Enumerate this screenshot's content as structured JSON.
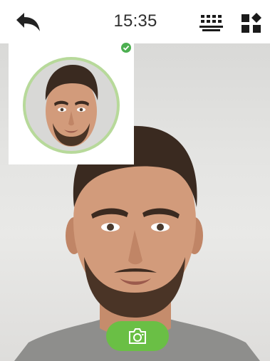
{
  "status_bar": {
    "time": "15:35",
    "icons": {
      "back": "back-arrow-icon",
      "keypad": "keypad-icon",
      "menu": "app-menu-icon"
    }
  },
  "preview": {
    "status_icon": "check-icon",
    "status_color": "#4caf50",
    "ring_color": "#b7d99a"
  },
  "capture": {
    "icon": "camera-icon",
    "color": "#6abf45"
  }
}
